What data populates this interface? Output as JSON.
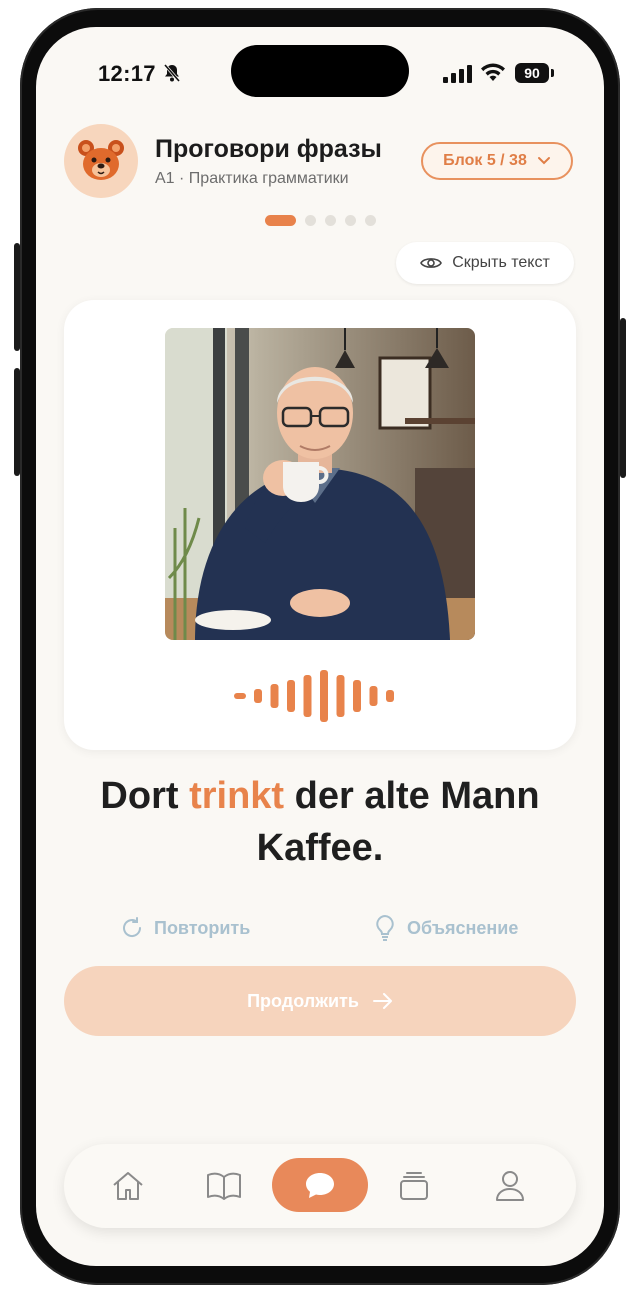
{
  "status_bar": {
    "time": "12:17",
    "battery": "90"
  },
  "header": {
    "title": "Проговори фразы",
    "subtitle": "A1 · Практика грамматики",
    "block_label": "Блок 5 / 38"
  },
  "progress": {
    "total": 5,
    "current": 1
  },
  "hide_text_label": "Скрыть текст",
  "phrase": {
    "before": "Dort ",
    "highlight": "trinkt",
    "after": " der alte Mann Kaffee."
  },
  "actions": {
    "repeat_label": "Повторить",
    "explain_label": "Объяснение"
  },
  "continue_label": "Продолжить",
  "colors": {
    "accent": "#e8834b",
    "background": "#faf8f4",
    "muted_action": "#a9c1cf"
  },
  "nav": [
    "home-icon",
    "book-icon",
    "chat-icon",
    "cards-icon",
    "profile-icon"
  ]
}
